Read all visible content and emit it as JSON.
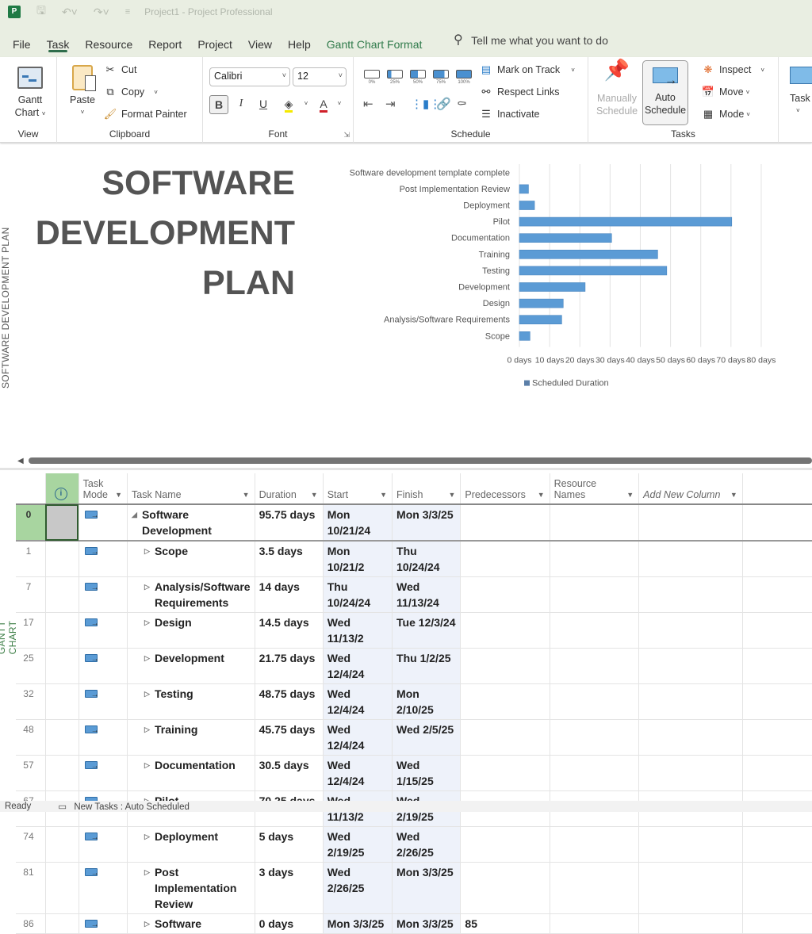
{
  "titlebar": {
    "title": "Project1  -  Project Professional",
    "app_icon": "P",
    "quick_access": [
      "save-icon",
      "undo-icon",
      "redo-icon",
      "customize-icon"
    ]
  },
  "menu": {
    "tabs": [
      "File",
      "Task",
      "Resource",
      "Report",
      "Project",
      "View",
      "Help"
    ],
    "active_tab": "Task",
    "contextual_tab": "Gantt Chart Format",
    "search_placeholder": "Tell me what you want to do"
  },
  "ribbon": {
    "view": {
      "label": "View",
      "gantt": "Gantt",
      "gantt2": "Chart"
    },
    "clipboard": {
      "label": "Clipboard",
      "paste": "Paste",
      "cut": "Cut",
      "copy": "Copy",
      "format_painter": "Format Painter"
    },
    "font": {
      "label": "Font",
      "family": "Calibri",
      "size": "12",
      "bold": "B",
      "italic": "I",
      "underline": "U",
      "font_color": "A"
    },
    "schedule": {
      "label": "Schedule",
      "percents": [
        "0%",
        "25%",
        "50%",
        "75%",
        "100%"
      ],
      "mark_on_track": "Mark on Track",
      "respect_links": "Respect Links",
      "inactivate": "Inactivate"
    },
    "tasks": {
      "label": "Tasks",
      "manual1": "Manually",
      "manual2": "Schedule",
      "auto1": "Auto",
      "auto2": "Schedule",
      "inspect": "Inspect",
      "move": "Move",
      "mode": "Mode",
      "task": "Task"
    }
  },
  "report": {
    "side_label": "SOFTWARE DEVELOPMENT PLAN",
    "title_lines": [
      "SOFTWARE",
      "DEVELOPMENT",
      "PLAN"
    ]
  },
  "chart_data": {
    "type": "bar",
    "orientation": "horizontal",
    "title": "",
    "categories": [
      "Software development template complete",
      "Post Implementation Review",
      "Deployment",
      "Pilot",
      "Documentation",
      "Training",
      "Testing",
      "Development",
      "Design",
      "Analysis/Software Requirements",
      "Scope"
    ],
    "series": [
      {
        "name": "Scheduled Duration",
        "values": [
          0,
          3,
          5,
          70.25,
          30.5,
          45.75,
          48.75,
          21.75,
          14.5,
          14,
          3.5
        ],
        "color": "#5b9bd5"
      }
    ],
    "xlabel": "",
    "ylabel": "",
    "xlim": [
      0,
      85
    ],
    "xticks": [
      "0 days",
      "10 days",
      "20 days",
      "30 days",
      "40 days",
      "50 days",
      "60 days",
      "70 days",
      "80 days"
    ],
    "grid": true,
    "legend": "bottom"
  },
  "view_label": "GANTT CHART",
  "table": {
    "headers": {
      "task_mode1": "Task",
      "task_mode2": "Mode",
      "task_name": "Task Name",
      "duration": "Duration",
      "start": "Start",
      "finish": "Finish",
      "predecessors": "Predecessors",
      "resource1": "Resource",
      "resource2": "Names",
      "add_col": "Add New Column"
    },
    "rows": [
      {
        "id": "0",
        "name": "Software Development",
        "duration": "95.75 days",
        "start": "Mon 10/21/24",
        "finish": "Mon 3/3/25",
        "pred": "",
        "summary": true
      },
      {
        "id": "1",
        "name": "Scope",
        "duration": "3.5 days",
        "start": "Mon 10/21/2",
        "finish": "Thu 10/24/24",
        "pred": ""
      },
      {
        "id": "7",
        "name": "Analysis/Software Requirements",
        "duration": "14 days",
        "start": "Thu 10/24/24",
        "finish": "Wed 11/13/24",
        "pred": ""
      },
      {
        "id": "17",
        "name": "Design",
        "duration": "14.5 days",
        "start": "Wed 11/13/2",
        "finish": "Tue 12/3/24",
        "pred": ""
      },
      {
        "id": "25",
        "name": "Development",
        "duration": "21.75 days",
        "start": "Wed 12/4/24",
        "finish": "Thu 1/2/25",
        "pred": ""
      },
      {
        "id": "32",
        "name": "Testing",
        "duration": "48.75 days",
        "start": "Wed 12/4/24",
        "finish": "Mon 2/10/25",
        "pred": ""
      },
      {
        "id": "48",
        "name": "Training",
        "duration": "45.75 days",
        "start": "Wed 12/4/24",
        "finish": "Wed 2/5/25",
        "pred": ""
      },
      {
        "id": "57",
        "name": "Documentation",
        "duration": "30.5 days",
        "start": "Wed 12/4/24",
        "finish": "Wed 1/15/25",
        "pred": ""
      },
      {
        "id": "67",
        "name": "Pilot",
        "duration": "70.25 days",
        "start": "Wed 11/13/2",
        "finish": "Wed 2/19/25",
        "pred": ""
      },
      {
        "id": "74",
        "name": "Deployment",
        "duration": "5 days",
        "start": "Wed 2/19/25",
        "finish": "Wed 2/26/25",
        "pred": ""
      },
      {
        "id": "81",
        "name": "Post Implementation Review",
        "duration": "3 days",
        "start": "Wed 2/26/25",
        "finish": "Mon 3/3/25",
        "pred": ""
      },
      {
        "id": "86",
        "name": "Software",
        "duration": "0 days",
        "start": "Mon 3/3/25",
        "finish": "Mon 3/3/25",
        "pred": "85"
      }
    ]
  },
  "status": {
    "ready": "Ready",
    "new_tasks": "New Tasks : Auto Scheduled"
  }
}
